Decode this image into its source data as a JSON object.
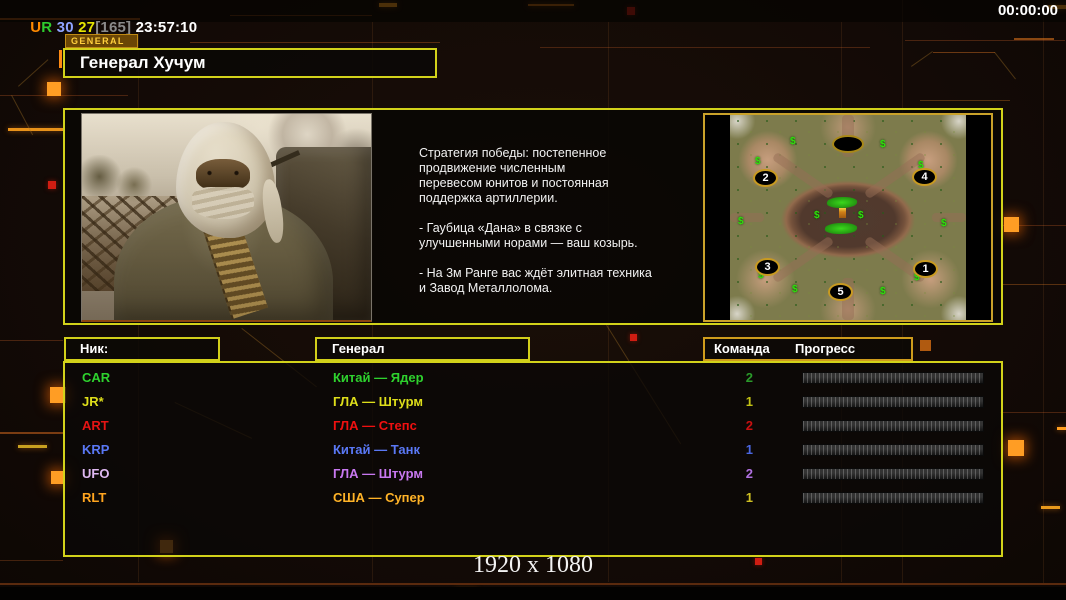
{
  "colors": {
    "panel_border": "#d2d21a",
    "accent_orange": "#ff9d1f",
    "tab_gold": "#ffcf3d"
  },
  "top_bar": {
    "score_parts": [
      {
        "text": "U",
        "color": "#ff8a00"
      },
      {
        "text": "R",
        "color": "#2ecc2e"
      },
      {
        "text": " 30",
        "color": "#8fa4ff"
      },
      {
        "text": " 27",
        "color": "#e6e600"
      },
      {
        "text": "[165]",
        "color": "#8a8a8a"
      },
      {
        "text": " 23:57:10",
        "color": "#ffffff"
      }
    ],
    "match_time": "00:00:00"
  },
  "general_tab": "GENERAL",
  "general_name": "Генерал Хучум",
  "briefing_lines": [
    "Стратегия победы: постепенное",
    "продвижение численным",
    "перевесом юнитов и постоянная",
    "поддержка артиллерии.",
    "",
    "- Гаубица «Дана» в связке с",
    "улучшенными норами — ваш козырь.",
    "",
    "- На 3м Ранге вас ждёт элитная техника",
    "и Завод Металлолома."
  ],
  "map": {
    "money_symbol": "$",
    "positions": [
      {
        "label": "2"
      },
      {
        "label": "4"
      },
      {
        "label": "3"
      },
      {
        "label": "1"
      },
      {
        "label": "5"
      }
    ]
  },
  "table": {
    "headers": {
      "nick": "Ник:",
      "general": "Генерал",
      "team": "Команда",
      "progress": "Прогресс"
    },
    "rows": [
      {
        "nick": "CAR",
        "general": "Китай — Ядер",
        "team": "2",
        "nick_color": "#2ed22e",
        "general_color": "#2ed22e",
        "team_color": "#2a9a2a"
      },
      {
        "nick": "JR*",
        "general": "ГЛА — Штурм",
        "team": "1",
        "nick_color": "#dede1a",
        "general_color": "#dede1a",
        "team_color": "#c2c214"
      },
      {
        "nick": "ART",
        "general": "ГЛА — Степс",
        "team": "2",
        "nick_color": "#e61414",
        "general_color": "#f01010",
        "team_color": "#c81010"
      },
      {
        "nick": "KRP",
        "general": "Китай — Танк",
        "team": "1",
        "nick_color": "#5a78f5",
        "general_color": "#5a78f5",
        "team_color": "#4a66e0"
      },
      {
        "nick": "UFO",
        "general": "ГЛА — Штурм",
        "team": "2",
        "nick_color": "#dfb9f2",
        "general_color": "#c878f0",
        "team_color": "#b070e0"
      },
      {
        "nick": "RLT",
        "general": "США — Супер",
        "team": "1",
        "nick_color": "#ffa51f",
        "general_color": "#ffb327",
        "team_color": "#cfc023"
      }
    ]
  },
  "footer_resolution": "1920 x 1080"
}
